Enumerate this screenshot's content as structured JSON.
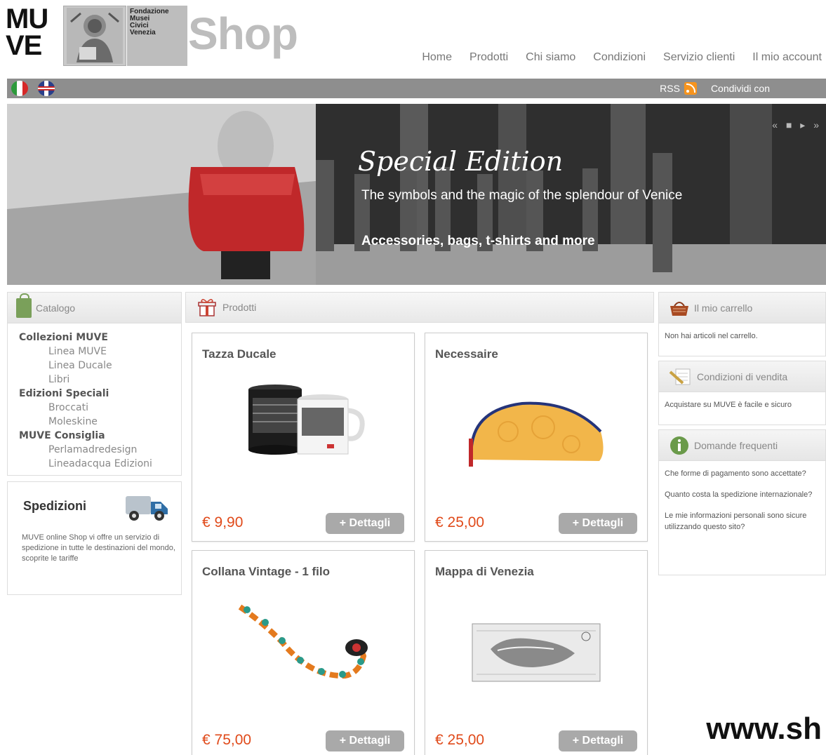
{
  "header": {
    "logo_muve": [
      "MU",
      "VE"
    ],
    "logo_fondazione": [
      "Fondazione",
      "Musei",
      "Civici",
      "Venezia"
    ],
    "logo_shop": "Shop",
    "nav": [
      "Home",
      "Prodotti",
      "Chi siamo",
      "Condizioni",
      "Servizio clienti",
      "Il mio account"
    ]
  },
  "topbar": {
    "rss": "RSS",
    "share": "Condividi con",
    "languages": [
      "italian-flag-icon",
      "uk-flag-icon"
    ]
  },
  "banner": {
    "title": "Special Edition",
    "subtitle": "The symbols and the magic of the splendour of Venice",
    "more": "Accessories, bags, t-shirts and more",
    "controls": "« ■ ▸ »"
  },
  "catalog": {
    "title": "Catalogo",
    "groups": [
      {
        "name": "Collezioni MUVE",
        "items": [
          "Linea MUVE",
          "Linea Ducale",
          "Libri"
        ]
      },
      {
        "name": "Edizioni Speciali",
        "items": [
          "Broccati",
          "Moleskine"
        ]
      },
      {
        "name": "MUVE Consiglia",
        "items": [
          "Perlamadredesign",
          "Lineadacqua Edizioni"
        ]
      }
    ]
  },
  "shipping": {
    "title": "Spedizioni",
    "text": "MUVE online Shop vi offre un servizio di spedizione in tutte le destinazioni del mondo, scoprite le tariffe"
  },
  "products": {
    "title": "Prodotti",
    "button_label": "+ Dettagli",
    "items": [
      {
        "name": "Tazza Ducale",
        "price": "€ 9,90"
      },
      {
        "name": "Necessaire",
        "price": "€ 25,00"
      },
      {
        "name": "Collana Vintage - 1 filo",
        "price": "€ 75,00"
      },
      {
        "name": "Mappa di Venezia",
        "price": "€ 25,00"
      }
    ]
  },
  "cart": {
    "title": "Il mio carrello",
    "empty": "Non hai articoli nel carrello."
  },
  "conditions": {
    "title": "Condizioni di vendita",
    "text": "Acquistare su MUVE è facile e sicuro"
  },
  "faq": {
    "title": "Domande frequenti",
    "items": [
      "Che forme di pagamento sono accettate?",
      "Quanto costa la spedizione internazionale?",
      "Le mie informazioni personali sono sicure utilizzando questo sito?"
    ]
  },
  "watermark": "www.sh",
  "colors": {
    "price": "#e04a1a",
    "bar": "#8e8e8e",
    "button": "#a9a9a9",
    "rss": "#f7941d"
  }
}
